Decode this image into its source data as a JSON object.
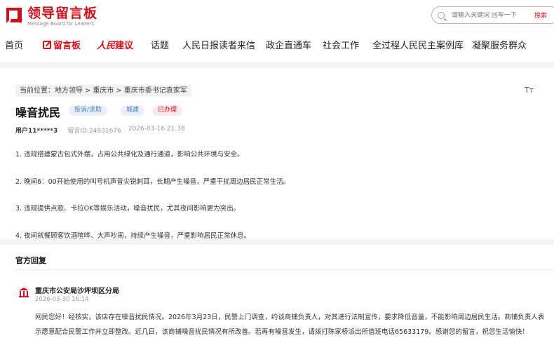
{
  "header": {
    "logo_cn": "领导留言板",
    "logo_en": "Message Board for Leaders",
    "search_placeholder": "请输入关键词 回车一下",
    "search_button": "搜索"
  },
  "nav": {
    "home": "首页",
    "board": "留言板",
    "suggest_prefix": "人民",
    "suggest": "建议",
    "topics": "话题",
    "readers": "人民日报读者来信",
    "gov": "政企直通车",
    "social": "社会工作",
    "cases": "全过程人民民主案例库",
    "service": "凝聚服务群众"
  },
  "breadcrumb": {
    "prefix": "当前位置：",
    "level1": "地方领导",
    "level2": "重庆市",
    "level3": "重庆市委书记袁家军",
    "sep": ">"
  },
  "font_toggle": "Tт",
  "message": {
    "title": "噪音扰民",
    "tag_type": "投诉/求助",
    "tag_domain": "城建",
    "tag_status": "已办理",
    "user": "用户11*****3",
    "id": "留言ID:24931676",
    "time": "2026-03-16 21:38",
    "paragraphs": [
      "1. 违规搭建蒙古包式外摆，占用公共绿化及通行通道，影响公共环境与安全。",
      "2. 晚间6：00开始使用的叫号机声音尖锐刺耳，长期产生噪音，严重干扰周边居民正常生活。",
      "3. 违规提供点歌、卡拉OK等娱乐活动，噪音扰民，尤其夜间影响更为突出。",
      "4. 夜间就餐顾客饮酒喧哗、大声吵闹，持续产生噪音，严重影响居民正常休息。"
    ]
  },
  "reply": {
    "section_title": "官方回复",
    "org": "重庆市公安局沙坪坝区分局",
    "time": "2026-03-30 16:14",
    "text": "网民您好！经核实，该店存在噪音扰民情况。2026年3月23日，民警上门调查，约谈商铺负责人，对其进行法制宣传，要求降低音量，不能影响周边居民生活。商铺负责人表示愿意配合民警工作并立即整改。近几日，该商铺噪音扰民情况有所改善。若再有噪音发生，请拨打陈家桥派出所值班电话65633179。感谢您的留言，祝您生活愉快！"
  },
  "colors": {
    "brand": "#d0111b",
    "tag_blue": "#4a7fc1"
  }
}
